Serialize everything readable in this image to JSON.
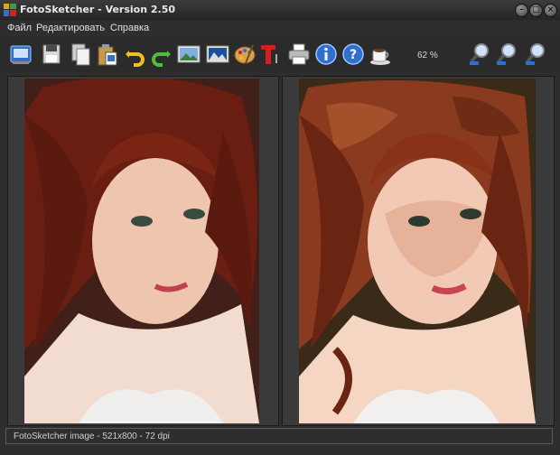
{
  "window": {
    "title": "FotoSketcher - Version 2.50"
  },
  "menu": [
    "Файл",
    "Редактировать",
    "Справка"
  ],
  "toolbar": {
    "zoom_label": "62 %",
    "buttons": [
      "open-icon",
      "save-icon",
      "copy-icon",
      "paste-icon",
      "undo-icon",
      "redo-icon",
      "image-icon",
      "landscape-icon",
      "palette-icon",
      "text-icon",
      "print-icon",
      "info-icon",
      "help-icon",
      "coffee-icon",
      "zoom-in-icon",
      "zoom-fit-icon",
      "zoom-out-icon"
    ]
  },
  "status": {
    "text": "FotoSketcher image - 521x800 - 72 dpi"
  },
  "colors": {
    "chrome": "#2e2e2e",
    "accent_blue": "#2f6fd0",
    "accent_red": "#d02020"
  }
}
